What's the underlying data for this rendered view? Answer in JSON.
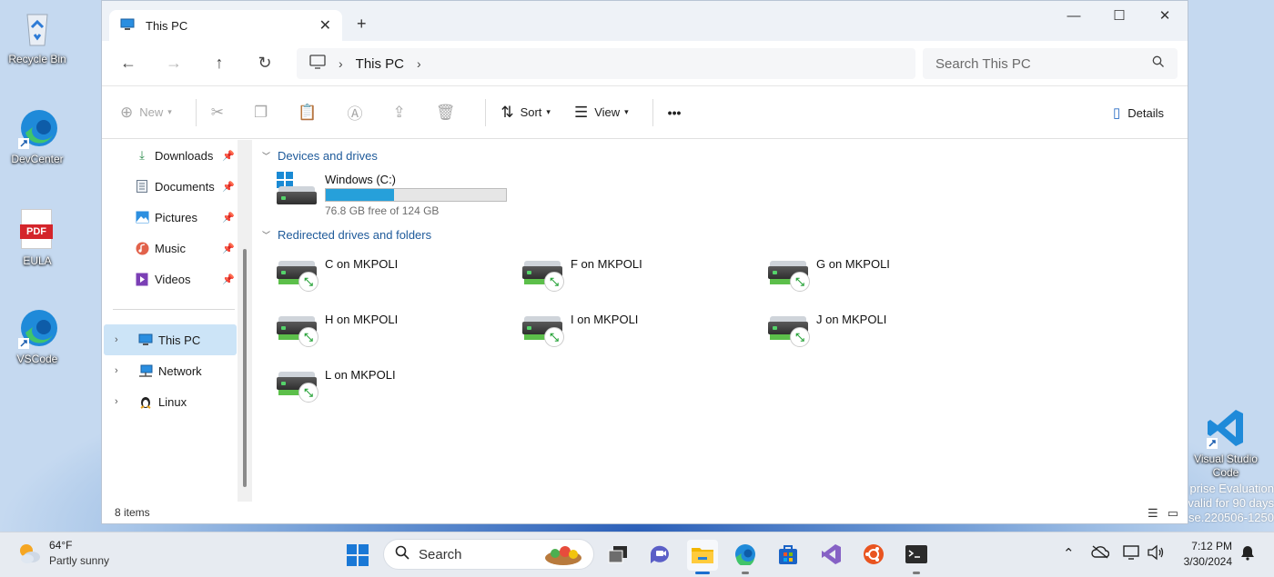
{
  "desktop": {
    "icons": [
      {
        "label": "Recycle Bin",
        "icon": "recycle-bin-icon"
      },
      {
        "label": "DevCenter",
        "icon": "edge-icon"
      },
      {
        "label": "EULA",
        "icon": "pdf-icon"
      },
      {
        "label": "VSCode",
        "icon": "edge-icon"
      },
      {
        "label": "Visual Studio Code",
        "icon": "vscode-icon"
      }
    ],
    "pdf_badge": "PDF",
    "watermark": [
      "prise Evaluation",
      "valid for 90 days",
      "se.220506-1250"
    ]
  },
  "window": {
    "tab_title": "This PC",
    "tab_close": "✕",
    "new_tab": "+",
    "controls": {
      "minimize": "—",
      "maximize": "☐",
      "close": "✕"
    }
  },
  "navbar": {
    "back": "←",
    "forward": "→",
    "up": "↑",
    "refresh": "↻",
    "breadcrumb": "This PC",
    "search_placeholder": "Search This PC"
  },
  "commandbar": {
    "new_label": "New",
    "sort_label": "Sort",
    "view_label": "View",
    "more_label": "•••",
    "details_label": "Details"
  },
  "sidebar": {
    "quick_access": [
      {
        "label": "Downloads",
        "icon": "download-icon"
      },
      {
        "label": "Documents",
        "icon": "document-icon"
      },
      {
        "label": "Pictures",
        "icon": "pictures-icon"
      },
      {
        "label": "Music",
        "icon": "music-icon"
      },
      {
        "label": "Videos",
        "icon": "video-icon"
      }
    ],
    "tree": [
      {
        "label": "This PC",
        "icon": "monitor-icon",
        "selected": true
      },
      {
        "label": "Network",
        "icon": "network-icon",
        "selected": false
      },
      {
        "label": "Linux",
        "icon": "linux-icon",
        "selected": false
      }
    ]
  },
  "content": {
    "devices_header": "Devices and drives",
    "redirected_header": "Redirected drives and folders",
    "local_drive": {
      "name": "Windows (C:)",
      "free_text": "76.8 GB free of 124 GB",
      "used_fraction": 0.38
    },
    "redirected": [
      "C on MKPOLI",
      "F on MKPOLI",
      "G on MKPOLI",
      "H on MKPOLI",
      "I on MKPOLI",
      "J on MKPOLI",
      "L on MKPOLI"
    ]
  },
  "statusbar": {
    "items_text": "8 items"
  },
  "taskbar": {
    "weather_temp": "64°F",
    "weather_desc": "Partly sunny",
    "search_label": "Search",
    "time": "7:12 PM",
    "date": "3/30/2024"
  },
  "colors": {
    "accent": "#26a0da",
    "selected": "#cce4f7",
    "group_header": "#1e5a9a"
  }
}
